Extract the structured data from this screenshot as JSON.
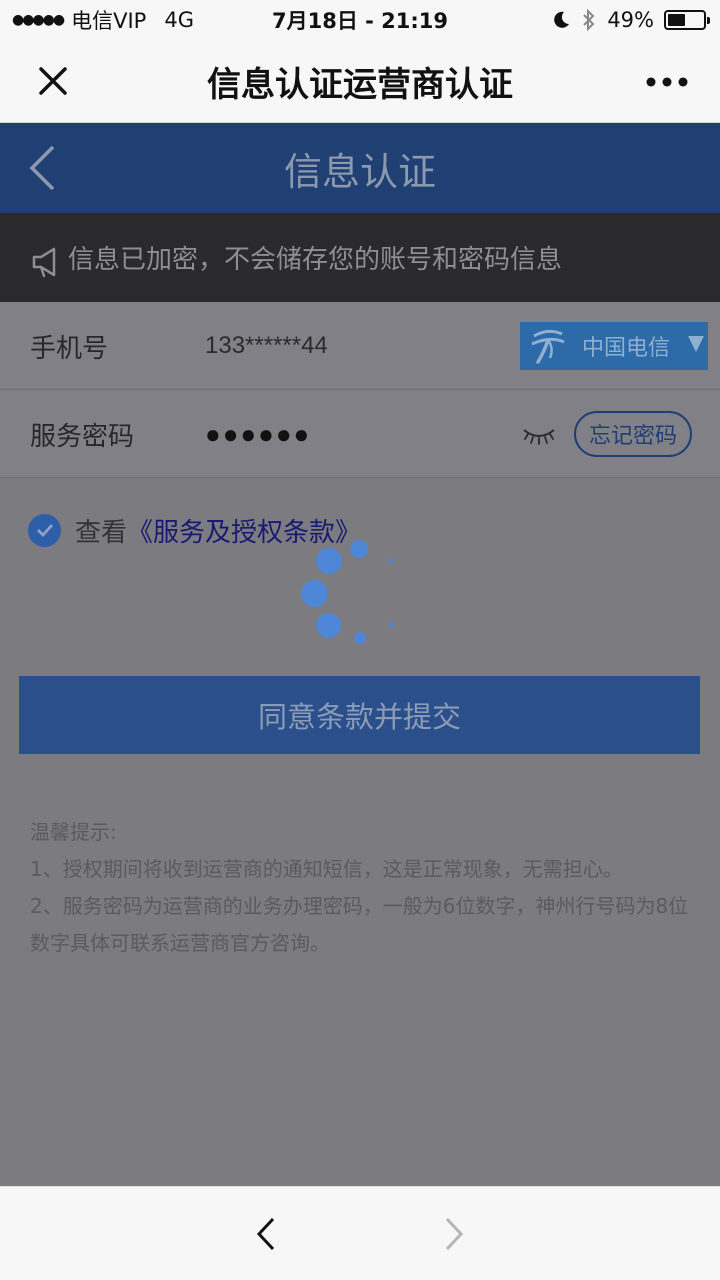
{
  "status_bar": {
    "signal": "●●●●●",
    "carrier": "电信VIP",
    "network": "4G",
    "time": "7月18日 - 21:19",
    "battery_percent": "49%",
    "battery_level": 0.49
  },
  "nav": {
    "title": "信息认证运营商认证",
    "close_icon": "close-icon",
    "more_icon": "more-icon"
  },
  "header": {
    "title": "信息认证",
    "back_icon": "chevron-left-icon"
  },
  "notice": {
    "icon": "megaphone-icon",
    "text": "信息已加密，不会储存您的账号和密码信息"
  },
  "form": {
    "phone_label": "手机号",
    "phone_value": "133******44",
    "carrier_name": "中国电信",
    "password_label": "服务密码",
    "password_value": "●●●●●●",
    "forgot_label": "忘记密码"
  },
  "agreement": {
    "prefix": "查看",
    "link": "《服务及授权条款》",
    "checked": true
  },
  "submit_label": "同意条款并提交",
  "tips": {
    "title": "温馨提示:",
    "line1": "1、授权期间将收到运营商的通知短信，这是正常现象，无需担心。",
    "line2": "2、服务密码为运营商的业务办理密码，一般为6位数字，神州行号码为8位数字具体可联系运营商官方咨询。"
  },
  "toolbar": {
    "back_icon": "chevron-left-icon",
    "forward_icon": "chevron-right-icon"
  },
  "colors": {
    "header_bg": "#203f73",
    "submit_bg": "#2a4f8a",
    "carrier_bg": "#2d6aa8",
    "spinner": "#4f87d8"
  }
}
